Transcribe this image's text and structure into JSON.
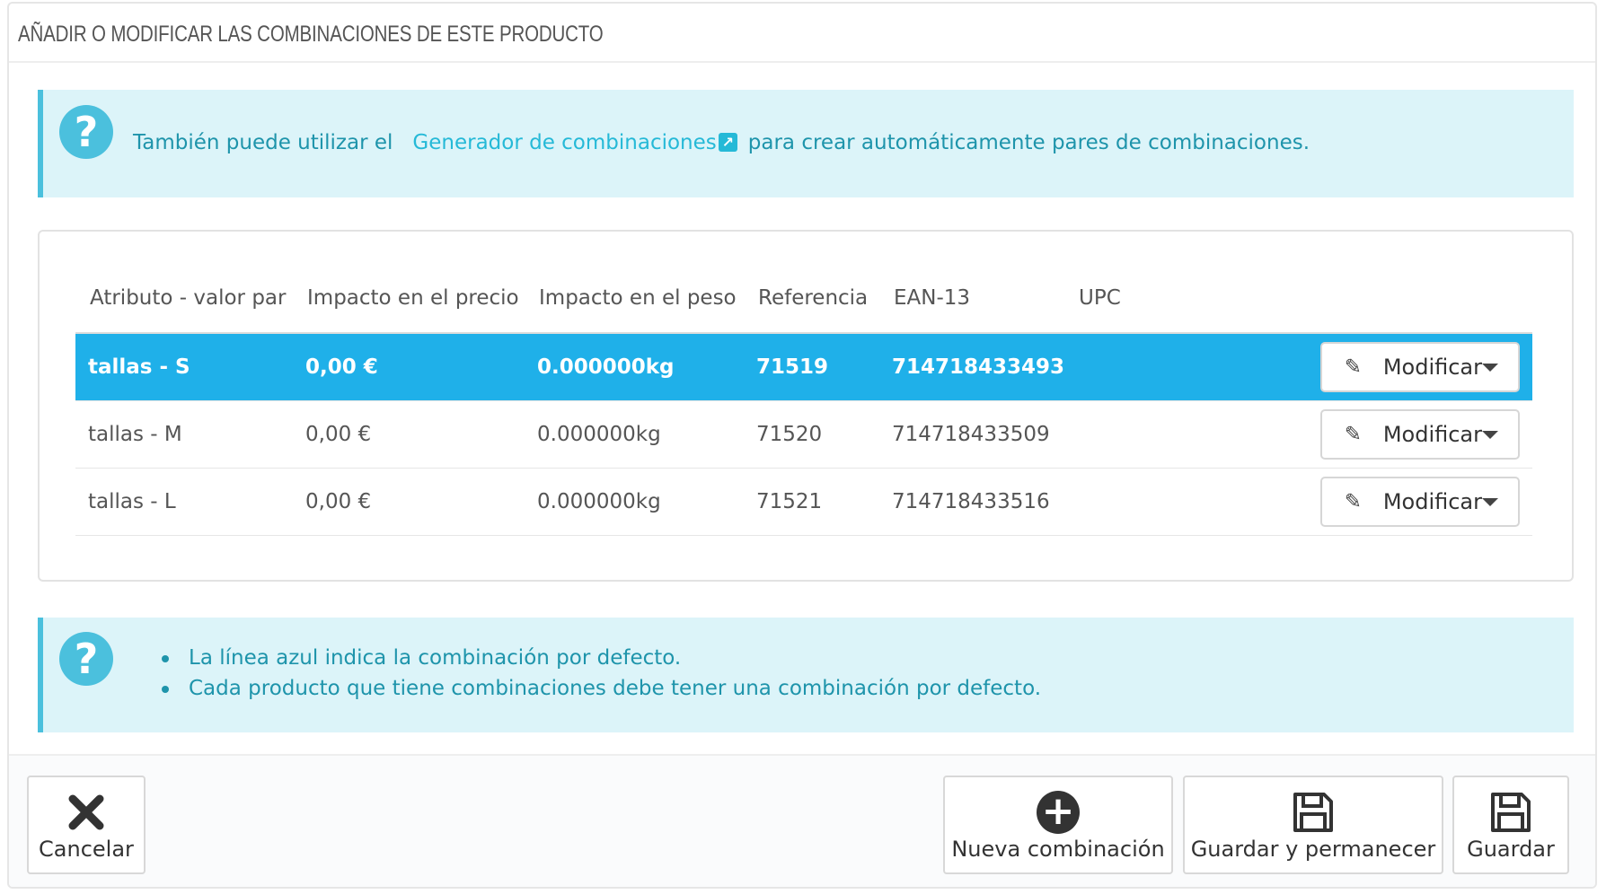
{
  "header": {
    "title": "AÑADIR O MODIFICAR LAS COMBINACIONES DE ESTE PRODUCTO"
  },
  "alert_top": {
    "icon": "question-circle-icon",
    "text_before": "También puede utilizar el",
    "link_text": "Generador de combinaciones",
    "text_after": "para crear automáticamente pares de combinaciones."
  },
  "table": {
    "columns": [
      "Atributo - valor par",
      "Impacto en el precio",
      "Impacto en el peso",
      "Referencia",
      "EAN-13",
      "UPC",
      ""
    ],
    "rows": [
      {
        "attribute": "tallas - S",
        "price": "0,00 €",
        "weight": "0.000000kg",
        "reference": "71519",
        "ean13": "714718433493",
        "upc": "",
        "action": "Modificar",
        "default": true
      },
      {
        "attribute": "tallas - M",
        "price": "0,00 €",
        "weight": "0.000000kg",
        "reference": "71520",
        "ean13": "714718433509",
        "upc": "",
        "action": "Modificar",
        "default": false
      },
      {
        "attribute": "tallas - L",
        "price": "0,00 €",
        "weight": "0.000000kg",
        "reference": "71521",
        "ean13": "714718433516",
        "upc": "",
        "action": "Modificar",
        "default": false
      }
    ]
  },
  "alert_bottom": {
    "icon": "question-circle-icon",
    "items": [
      "La línea azul indica la combinación por defecto.",
      "Cada producto que tiene combinaciones debe tener una combinación por defecto."
    ]
  },
  "footer": {
    "cancel": "Cancelar",
    "new_combination": "Nueva combinación",
    "save_stay": "Guardar y permanecer",
    "save": "Guardar"
  },
  "colors": {
    "highlight": "#1fb0e9",
    "alert_bg": "#dcf4f9",
    "alert_border": "#4bc0dd",
    "link": "#25b9d7"
  }
}
